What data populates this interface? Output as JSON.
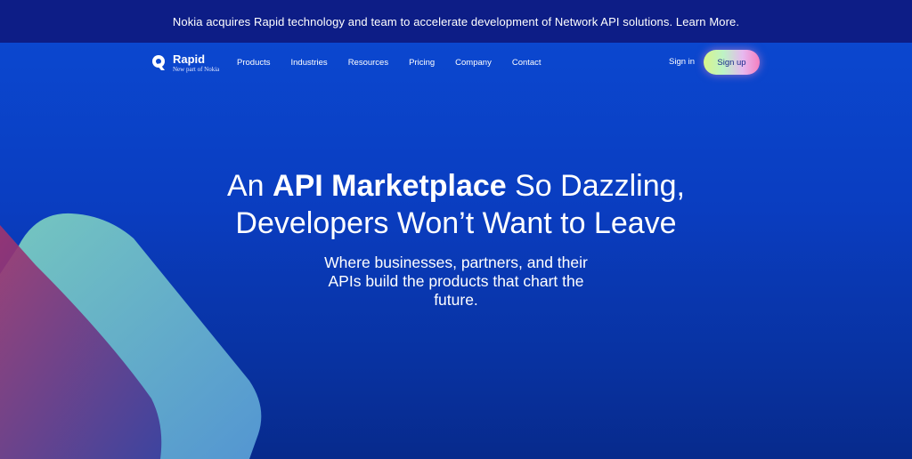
{
  "announcement": {
    "text": "Nokia acquires Rapid technology and team to accelerate development of Network API solutions. Learn More."
  },
  "nav": {
    "logo_name": "Rapid",
    "logo_sub": "New part of Nokia",
    "links": [
      "Products",
      "Industries",
      "Resources",
      "Pricing",
      "Company",
      "Contact"
    ],
    "signin_label": "Sign in",
    "signup_label": "Sign up"
  },
  "hero": {
    "headline_pre": "An ",
    "headline_bold": "API Marketplace",
    "headline_post": " So Dazzling,",
    "headline_line2": "Developers Won’t Want to Leave",
    "subheadline": "Where businesses, partners, and their APIs build the products that chart the future."
  },
  "colors": {
    "announce_bg": "#0d1d86",
    "hero_bg": "#0a40c4",
    "shape_teal": "#6fc6c4",
    "shape_magenta": "#9b2f74"
  }
}
